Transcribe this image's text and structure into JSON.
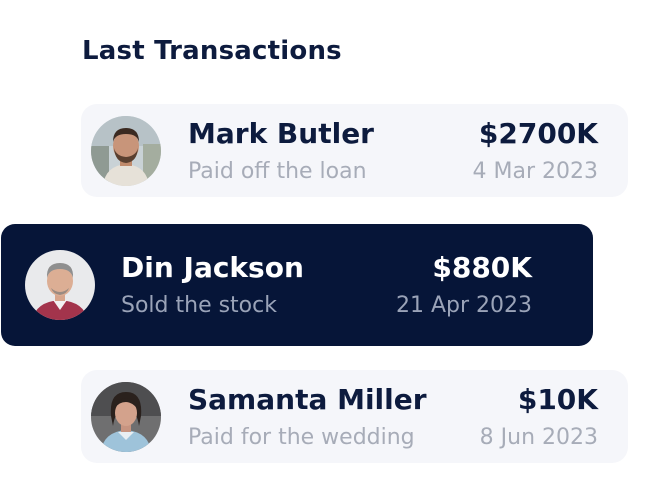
{
  "section": {
    "title": "Last Transactions"
  },
  "transactions": [
    {
      "name": "Mark Butler",
      "description": "Paid off the loan",
      "amount": "$2700K",
      "date": "4 Mar 2023",
      "avatar_icon": "avatar-man-beard-icon"
    },
    {
      "name": "Din Jackson",
      "description": "Sold the stock",
      "amount": "$880K",
      "date": "21 Apr 2023",
      "avatar_icon": "avatar-man-gray-hair-icon",
      "selected": true
    },
    {
      "name": "Samanta Miller",
      "description": "Paid for the wedding",
      "amount": "$10K",
      "date": "8 Jun 2023",
      "avatar_icon": "avatar-woman-icon"
    }
  ],
  "colors": {
    "title": "#0d1b3e",
    "card_background": "#f5f6fa",
    "selected_card_background": "#061538",
    "muted_text": "#a7acb8"
  }
}
